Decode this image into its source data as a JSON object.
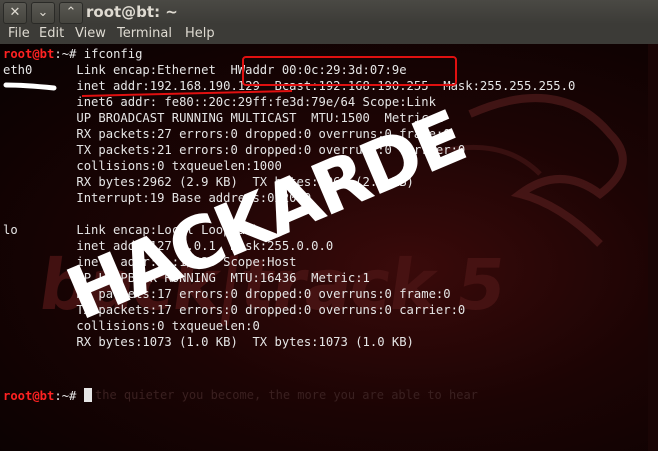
{
  "window": {
    "title": "root@bt: ~",
    "buttons": [
      "✕",
      "⌄",
      "⌃"
    ]
  },
  "menu": [
    "File",
    "Edit",
    "View",
    "Terminal",
    "Help"
  ],
  "terminal": {
    "prompt": "root@bt",
    "prompt_rest": ":~# ",
    "command": "ifconfig",
    "lines": [
      "eth0      Link encap:Ethernet  HWaddr 00:0c:29:3d:07:9e",
      "          inet addr:192.168.190.129  Bcast:192.168.190.255  Mask:255.255.255.0",
      "          inet6 addr: fe80::20c:29ff:fe3d:79e/64 Scope:Link",
      "          UP BROADCAST RUNNING MULTICAST  MTU:1500  Metric:1",
      "          RX packets:27 errors:0 dropped:0 overruns:0 frame:0",
      "          TX packets:21 errors:0 dropped:0 overruns:0 carrier:0",
      "          collisions:0 txqueuelen:1000",
      "          RX bytes:2962 (2.9 KB)  TX bytes:2064 (2.0 KB)",
      "          Interrupt:19 Base address:0x2000",
      "",
      "lo        Link encap:Local Loopback",
      "          inet addr:127.0.0.1  Mask:255.0.0.0",
      "          inet6 addr: ::1/128 Scope:Host",
      "          UP LOOPBACK RUNNING  MTU:16436  Metric:1",
      "          RX packets:17 errors:0 dropped:0 overruns:0 frame:0",
      "          TX packets:17 errors:0 dropped:0 overruns:0 carrier:0",
      "          collisions:0 txqueuelen:0",
      "          RX bytes:1073 (1.0 KB)  TX bytes:1073 (1.0 KB)",
      ""
    ],
    "final_prompt": "root@bt",
    "final_prompt_rest": ":~# ",
    "faint_quote": "the quieter you become, the more you are able to hear"
  },
  "wallpaper": {
    "watermark_text": "back|track 5",
    "scrawl_text": "HACKARDE"
  },
  "colors": {
    "prompt": "#ff2222",
    "text": "#e6e6e6",
    "annotation": "#e01010"
  }
}
